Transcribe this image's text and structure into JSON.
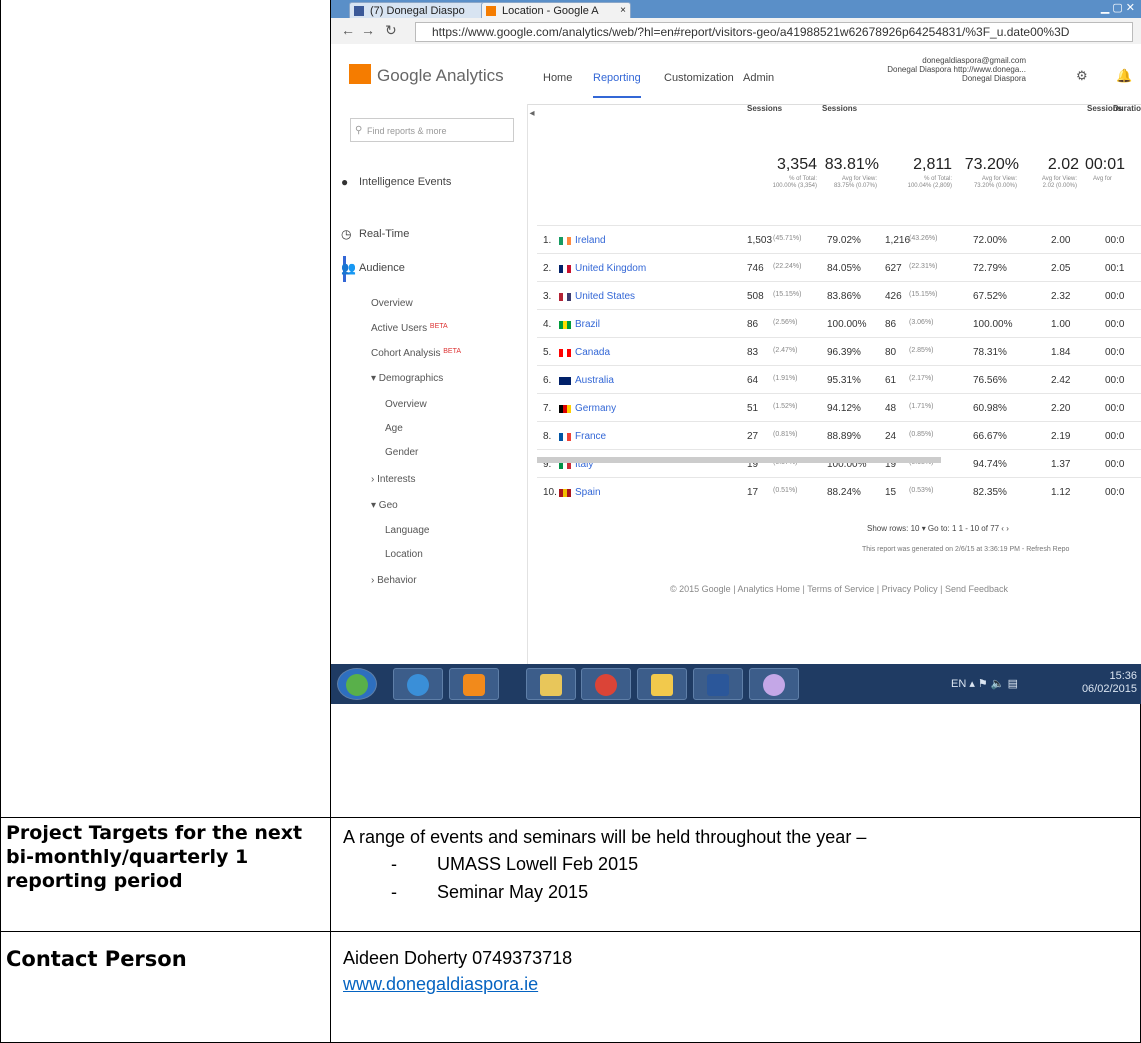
{
  "row_project": {
    "label": "Project Targets for the next bi-monthly/quarterly 1 reporting period",
    "intro": "A range of events and seminars will be held throughout the year –",
    "items": [
      "UMASS Lowell  Feb 2015",
      "Seminar May 2015"
    ]
  },
  "row_contact": {
    "label": "Contact Person",
    "line1": "Aideen Doherty 0749373718",
    "link": "www.donegaldiaspora.ie"
  },
  "screenshot": {
    "tabs": [
      "(7) Donegal Diaspo",
      "Location - Google A"
    ],
    "url": "https://www.google.com/analytics/web/?hl=en#report/visitors-geo/a41988521w62678926p64254831/%3F_u.date00%3D",
    "logo": "Google Analytics",
    "nav": [
      "Home",
      "Reporting",
      "Customization",
      "Admin"
    ],
    "account": [
      "donegaldiaspora@gmail.com",
      "Donegal Diaspora  http://www.donega...",
      "Donegal Diaspora"
    ],
    "search_placeholder": "Find reports & more",
    "sidebar": {
      "main": [
        "Intelligence Events",
        "Real-Time",
        "Audience"
      ],
      "audience_sub": [
        "Overview",
        "Active Users",
        "Cohort Analysis",
        "▾ Demographics",
        "Overview",
        "Age",
        "Gender",
        "› Interests",
        "▾ Geo",
        "Language",
        "Location",
        "› Behavior"
      ],
      "beta": "BETA"
    },
    "columns": [
      "Sessions",
      "Sessions",
      "",
      "",
      "Sessions",
      "Duration"
    ],
    "totals": [
      {
        "value": "3,354",
        "sub": "% of Total: 100.00% (3,354)"
      },
      {
        "value": "83.81%",
        "sub": "Avg for View: 83.75% (0.07%)"
      },
      {
        "value": "2,811",
        "sub": "% of Total: 100.04% (2,809)"
      },
      {
        "value": "73.20%",
        "sub": "Avg for View: 73.20% (0.00%)"
      },
      {
        "value": "2.02",
        "sub": "Avg for View: 2.02 (0.00%)"
      },
      {
        "value": "00:01",
        "sub": "Avg for"
      }
    ],
    "rows": [
      {
        "n": "1.",
        "country": "Ireland",
        "sessions": "1,503",
        "sess_pct": "(45.71%)",
        "new_pct": "79.02%",
        "users": "1,216",
        "users_pct": "(43.26%)",
        "bounce": "72.00%",
        "pages": "2.00",
        "dur": "00:0",
        "flag": [
          "#169b62",
          "#ffffff",
          "#ff883e"
        ]
      },
      {
        "n": "2.",
        "country": "United Kingdom",
        "sessions": "746",
        "sess_pct": "(22.24%)",
        "new_pct": "84.05%",
        "users": "627",
        "users_pct": "(22.31%)",
        "bounce": "72.79%",
        "pages": "2.05",
        "dur": "00:1",
        "flag": [
          "#012169",
          "#ffffff",
          "#c8102e"
        ]
      },
      {
        "n": "3.",
        "country": "United States",
        "sessions": "508",
        "sess_pct": "(15.15%)",
        "new_pct": "83.86%",
        "users": "426",
        "users_pct": "(15.15%)",
        "bounce": "67.52%",
        "pages": "2.32",
        "dur": "00:0",
        "flag": [
          "#b22234",
          "#ffffff",
          "#3c3b6e"
        ]
      },
      {
        "n": "4.",
        "country": "Brazil",
        "sessions": "86",
        "sess_pct": "(2.56%)",
        "new_pct": "100.00%",
        "users": "86",
        "users_pct": "(3.06%)",
        "bounce": "100.00%",
        "pages": "1.00",
        "dur": "00:0",
        "flag": [
          "#009c3b",
          "#ffdf00",
          "#009c3b"
        ]
      },
      {
        "n": "5.",
        "country": "Canada",
        "sessions": "83",
        "sess_pct": "(2.47%)",
        "new_pct": "96.39%",
        "users": "80",
        "users_pct": "(2.85%)",
        "bounce": "78.31%",
        "pages": "1.84",
        "dur": "00:0",
        "flag": [
          "#ff0000",
          "#ffffff",
          "#ff0000"
        ]
      },
      {
        "n": "6.",
        "country": "Australia",
        "sessions": "64",
        "sess_pct": "(1.91%)",
        "new_pct": "95.31%",
        "users": "61",
        "users_pct": "(2.17%)",
        "bounce": "76.56%",
        "pages": "2.42",
        "dur": "00:0",
        "flag": [
          "#012169",
          "#012169",
          "#012169"
        ]
      },
      {
        "n": "7.",
        "country": "Germany",
        "sessions": "51",
        "sess_pct": "(1.52%)",
        "new_pct": "94.12%",
        "users": "48",
        "users_pct": "(1.71%)",
        "bounce": "60.98%",
        "pages": "2.20",
        "dur": "00:0",
        "flag": [
          "#000000",
          "#dd0000",
          "#ffce00"
        ]
      },
      {
        "n": "8.",
        "country": "France",
        "sessions": "27",
        "sess_pct": "(0.81%)",
        "new_pct": "88.89%",
        "users": "24",
        "users_pct": "(0.85%)",
        "bounce": "66.67%",
        "pages": "2.19",
        "dur": "00:0",
        "flag": [
          "#0055a4",
          "#ffffff",
          "#ef4135"
        ]
      },
      {
        "n": "9.",
        "country": "Italy",
        "sessions": "19",
        "sess_pct": "(0.57%)",
        "new_pct": "100.00%",
        "users": "19",
        "users_pct": "(0.68%)",
        "bounce": "94.74%",
        "pages": "1.37",
        "dur": "00:0",
        "flag": [
          "#009246",
          "#ffffff",
          "#ce2b37"
        ]
      },
      {
        "n": "10.",
        "country": "Spain",
        "sessions": "17",
        "sess_pct": "(0.51%)",
        "new_pct": "88.24%",
        "users": "15",
        "users_pct": "(0.53%)",
        "bounce": "82.35%",
        "pages": "1.12",
        "dur": "00:0",
        "flag": [
          "#aa151b",
          "#f1bf00",
          "#aa151b"
        ]
      }
    ],
    "pager": "Show rows:  10   ▾  Go to:  1     1 - 10 of 77    ‹   ›",
    "generated": "This report was generated on 2/6/15 at 3:36:19 PM - Refresh Repo",
    "footer": "© 2015 Google | Analytics Home | Terms of Service | Privacy Policy | Send Feedback",
    "tray_lang": "EN",
    "time": "15:36",
    "date": "06/02/2015"
  }
}
